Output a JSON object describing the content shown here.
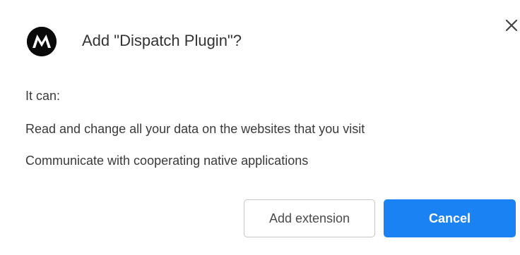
{
  "dialog": {
    "logo_icon": "motorola-logo-icon",
    "title": "Add \"Dispatch Plugin\"?",
    "close_icon": "close-icon",
    "permissions_heading": "It can:",
    "permissions": [
      "Read and change all your data on the websites that you visit",
      "Communicate with cooperating native applications"
    ],
    "add_button_label": "Add extension",
    "cancel_button_label": "Cancel"
  },
  "colors": {
    "accent": "#1a82f2",
    "text": "#333333",
    "logo_bg": "#0a0a0a"
  }
}
